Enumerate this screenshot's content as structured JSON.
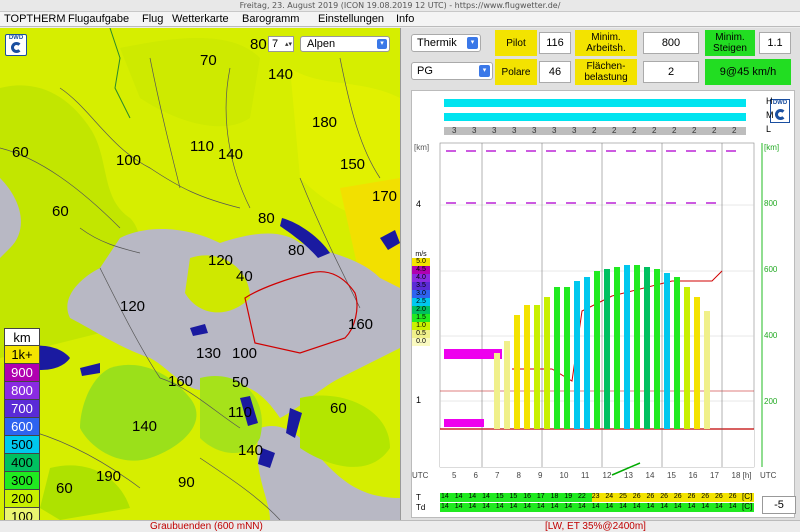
{
  "window": {
    "title": "Freitag, 23. August 2019 (ICON 19.08.2019 12 UTC) - https://www.flugwetter.de/"
  },
  "menu": {
    "items": [
      "TOPTHERM",
      "Flugaufgabe",
      "Flug",
      "Wetterkarte",
      "Barogramm",
      "Einstellungen",
      "Info"
    ]
  },
  "map": {
    "zoom_value": "7",
    "region_value": "Alpen",
    "logo_text": "DWD",
    "contour_labels": [
      "80",
      "70",
      "140",
      "60",
      "100",
      "110",
      "140",
      "180",
      "150",
      "170",
      "60",
      "80",
      "80",
      "120",
      "40",
      "120",
      "160",
      "130",
      "100",
      "50",
      "160",
      "110",
      "140",
      "190",
      "140",
      "60",
      "90",
      "60"
    ],
    "legend": {
      "unit": "km",
      "levels": [
        "1k+",
        "900",
        "800",
        "700",
        "600",
        "500",
        "400",
        "300",
        "200",
        "100"
      ],
      "colors": [
        "#f4e400",
        "#b000b0",
        "#8a2be2",
        "#5a2bd6",
        "#2e63f0",
        "#00c8ee",
        "#00c060",
        "#20ea20",
        "#c8f000",
        "#eaf570"
      ]
    }
  },
  "panel": {
    "mode_select": "Thermik",
    "glider_select": "PG",
    "pilot_label": "Pilot",
    "pilot_value": "116",
    "min_work_label": "Minim. Arbeitsh.",
    "min_work_value": "800",
    "min_climb_label": "Minim. Steigen",
    "min_climb_value": "1.1",
    "polar_label": "Polare",
    "polar_value": "46",
    "wing_load_label": "Flächen-belastung",
    "wing_load_value": "2",
    "result_value": "9@45 km/h",
    "offset_value": "-5"
  },
  "meteogram": {
    "row_labels": [
      "H",
      "M",
      "L"
    ],
    "left_unit": "[km]",
    "right_unit": "[km]",
    "left_ticks": [
      "4",
      "1"
    ],
    "right_ticks": [
      "800",
      "600",
      "400",
      "200"
    ],
    "x_label_left": "UTC",
    "x_label_right": "UTC",
    "x_ticks": [
      "5",
      "6",
      "7",
      "8",
      "9",
      "10",
      "11",
      "12",
      "13",
      "14",
      "15",
      "16",
      "17",
      "18 [h]"
    ],
    "low_cloud_values": [
      "3",
      "3",
      "3",
      "3",
      "3",
      "3",
      "3",
      "2",
      "2",
      "2",
      "2",
      "2",
      "2",
      "2",
      "2"
    ],
    "ms_label": "m/s",
    "ms_scale": [
      "5.0",
      "4.5",
      "4.0",
      "3.5",
      "3.0",
      "2.5",
      "2.0",
      "1.5",
      "1.0",
      "0.5",
      "0.0"
    ],
    "ms_colors": [
      "#f4e400",
      "#b000b0",
      "#8a2be2",
      "#5a2bd6",
      "#2e63f0",
      "#00c8ee",
      "#00c060",
      "#20ea20",
      "#c8f000",
      "#f0f08a",
      "#fafac0"
    ],
    "t_label": "T",
    "td_label": "Td",
    "t_values": [
      "14",
      "14",
      "14",
      "14",
      "15",
      "15",
      "16",
      "17",
      "18",
      "19",
      "22",
      "23",
      "24",
      "25",
      "26",
      "26",
      "26",
      "26",
      "26",
      "26",
      "26",
      "26"
    ],
    "td_values": [
      "14",
      "14",
      "14",
      "14",
      "14",
      "14",
      "14",
      "14",
      "14",
      "14",
      "14",
      "14",
      "14",
      "14",
      "14",
      "14",
      "14",
      "14",
      "14",
      "14",
      "14",
      "14"
    ],
    "bracket_c": "[C]"
  },
  "status": {
    "left": "Graubuenden (600 mNN)",
    "right": "[LW, ET  35%@2400m]"
  }
}
